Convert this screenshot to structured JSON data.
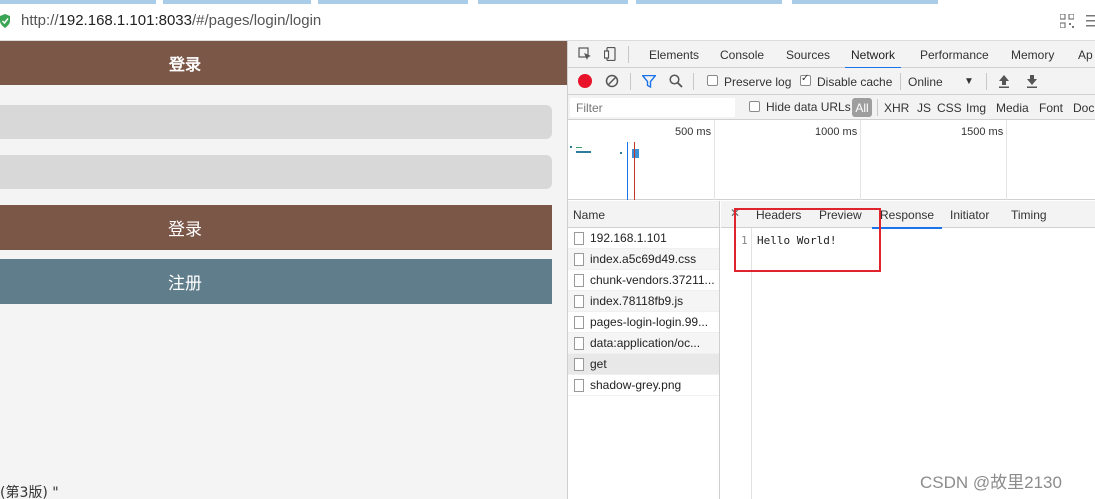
{
  "browser": {
    "url_prefix": "http://",
    "url_host": "192.168.1.101:8033",
    "url_path": "/#/pages/login/login"
  },
  "app": {
    "header_title": "登录",
    "login_button": "登录",
    "register_button": "注册",
    "footer_note": "(第3版) \""
  },
  "devtools": {
    "tabs": [
      "Elements",
      "Console",
      "Sources",
      "Network",
      "Performance",
      "Memory",
      "Ap"
    ],
    "active_tab": "Network",
    "toolbar": {
      "preserve_log": "Preserve log",
      "disable_cache": "Disable cache",
      "throttle": "Online"
    },
    "filter": {
      "placeholder": "Filter",
      "hide_data_urls": "Hide data URLs",
      "all": "All",
      "types": [
        "XHR",
        "JS",
        "CSS",
        "Img",
        "Media",
        "Font",
        "Doc"
      ]
    },
    "overview_ticks": [
      "500 ms",
      "1000 ms",
      "1500 ms"
    ],
    "name_column_header": "Name",
    "requests": [
      "192.168.1.101",
      "index.a5c69d49.css",
      "chunk-vendors.37211...",
      "index.78118fb9.js",
      "pages-login-login.99...",
      "data:application/oc...",
      "get",
      "shadow-grey.png"
    ],
    "detail_tabs": [
      "Headers",
      "Preview",
      "Response",
      "Initiator",
      "Timing"
    ],
    "active_detail_tab": "Response",
    "response_line_number": "1",
    "response_body": "Hello World!"
  },
  "watermark": "CSDN @故里2130",
  "colors": {
    "brown": "#7b5748",
    "slate": "#607d8b",
    "highlight": "#e0242c",
    "accent": "#1a73e8"
  }
}
